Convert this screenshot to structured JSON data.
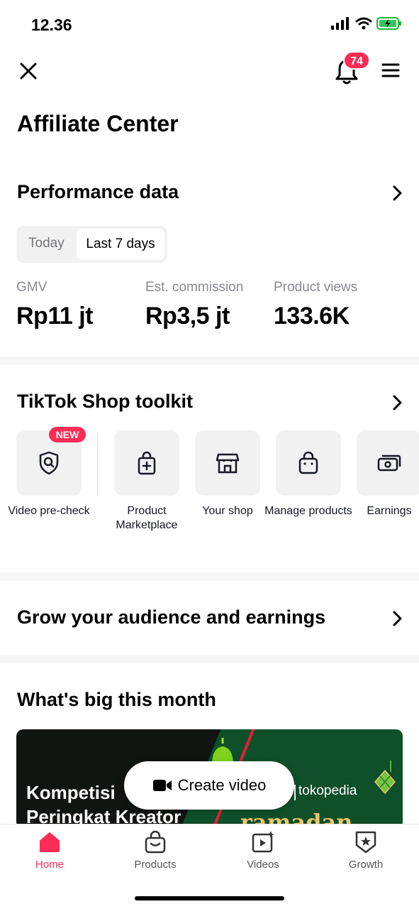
{
  "status_bar": {
    "time": "12.36",
    "icons": [
      "signal-icon",
      "wifi-icon",
      "battery-charging-icon"
    ]
  },
  "top_bar": {
    "notification_count": "74",
    "icons": [
      "close-icon",
      "bell-icon",
      "menu-icon"
    ]
  },
  "page_title": "Affiliate Center",
  "performance": {
    "title": "Performance data",
    "tabs": [
      "Today",
      "Last 7 days"
    ],
    "active_tab": "Last 7 days",
    "metrics": [
      {
        "label": "GMV",
        "value": "Rp11 jt"
      },
      {
        "label": "Est. commission",
        "value": "Rp3,5 jt"
      },
      {
        "label": "Product views",
        "value": "133.6K"
      }
    ]
  },
  "toolkit": {
    "title": "TikTok Shop toolkit",
    "new_badge": "NEW",
    "items": [
      {
        "label": "Video pre-check",
        "icon": "shield-search-icon"
      },
      {
        "label": "Product Marketplace",
        "icon": "bag-plus-icon"
      },
      {
        "label": "Your shop",
        "icon": "storefront-icon"
      },
      {
        "label": "Manage products",
        "icon": "shopping-bag-icon"
      },
      {
        "label": "Earnings",
        "icon": "cash-icon"
      }
    ]
  },
  "grow": {
    "title": "Grow your audience and earnings"
  },
  "big_month": {
    "title": "What's big this month",
    "banner": {
      "text_line1": "Kompetisi",
      "text_line2": "Peringkat Kreator",
      "brand": "tokopedia",
      "ramadan": "ramadan"
    }
  },
  "create_video": {
    "label": "Create video"
  },
  "bottom_nav": {
    "items": [
      {
        "label": "Home",
        "active": true,
        "icon": "home-icon"
      },
      {
        "label": "Products",
        "active": false,
        "icon": "shopping-bag-icon"
      },
      {
        "label": "Videos",
        "active": false,
        "icon": "video-play-icon"
      },
      {
        "label": "Growth",
        "active": false,
        "icon": "star-badge-icon"
      }
    ]
  },
  "colors": {
    "accent": "#fe2c55",
    "text": "#161823",
    "muted": "#8a8b91",
    "tile": "#f1f1f2"
  }
}
